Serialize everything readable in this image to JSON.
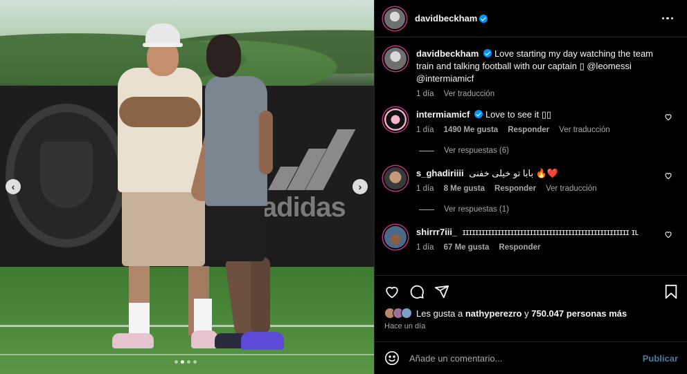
{
  "post": {
    "username": "davidbeckham",
    "carousel": {
      "slides": 4,
      "active": 2
    },
    "photo_logo_text": "adidas"
  },
  "caption": {
    "username": "davidbeckham",
    "text": "Love starting my day watching the team train and talking football with our captain ▯ @leomessi @intermiamicf",
    "time": "1 día",
    "translate": "Ver traducción"
  },
  "comments": [
    {
      "username": "intermiamicf",
      "text": "Love to see it ▯▯",
      "time": "1 día",
      "likes": "1490 Me gusta",
      "reply": "Responder",
      "translate": "Ver traducción",
      "replies_label": "Ver respuestas (6)"
    },
    {
      "username": "s_ghadiriiii",
      "text": "بابا تو خیلی خفنی 🔥❤️",
      "time": "1 día",
      "likes": "8 Me gusta",
      "reply": "Responder",
      "translate": "Ver traducción",
      "replies_label": "Ver respuestas (1)"
    },
    {
      "username": "shirrr7iii_",
      "text": "ɪɪɪɪɪɪɪɪɪɪɪɪɪɪɪɪɪɪɪɪɪɪɪɪɪɪɪɪɪɪɪɪɪɪɪɪɪɪɪɪɪɪɪɪɪɪɪɪɪɪɪɪ ɪʟ",
      "time": "1 día",
      "likes": "67 Me gusta",
      "reply": "Responder"
    }
  ],
  "likes": {
    "prefix": "Les gusta a",
    "user": "nathyperezro",
    "joiner": "y",
    "others": "750.047 personas más",
    "time_ago": "Hace un día"
  },
  "add_comment": {
    "placeholder": "Añade un comentario...",
    "publish_label": "Publicar"
  },
  "colors": {
    "background": "#000000",
    "verified": "#0095f6",
    "muted_text": "#a8a8a8",
    "publish_disabled": "#4a7a9c"
  },
  "icons": [
    "more-icon",
    "heart-icon",
    "comment-icon",
    "share-icon",
    "bookmark-icon",
    "emoji-icon",
    "chevron-left-icon",
    "chevron-right-icon",
    "verified-icon"
  ]
}
